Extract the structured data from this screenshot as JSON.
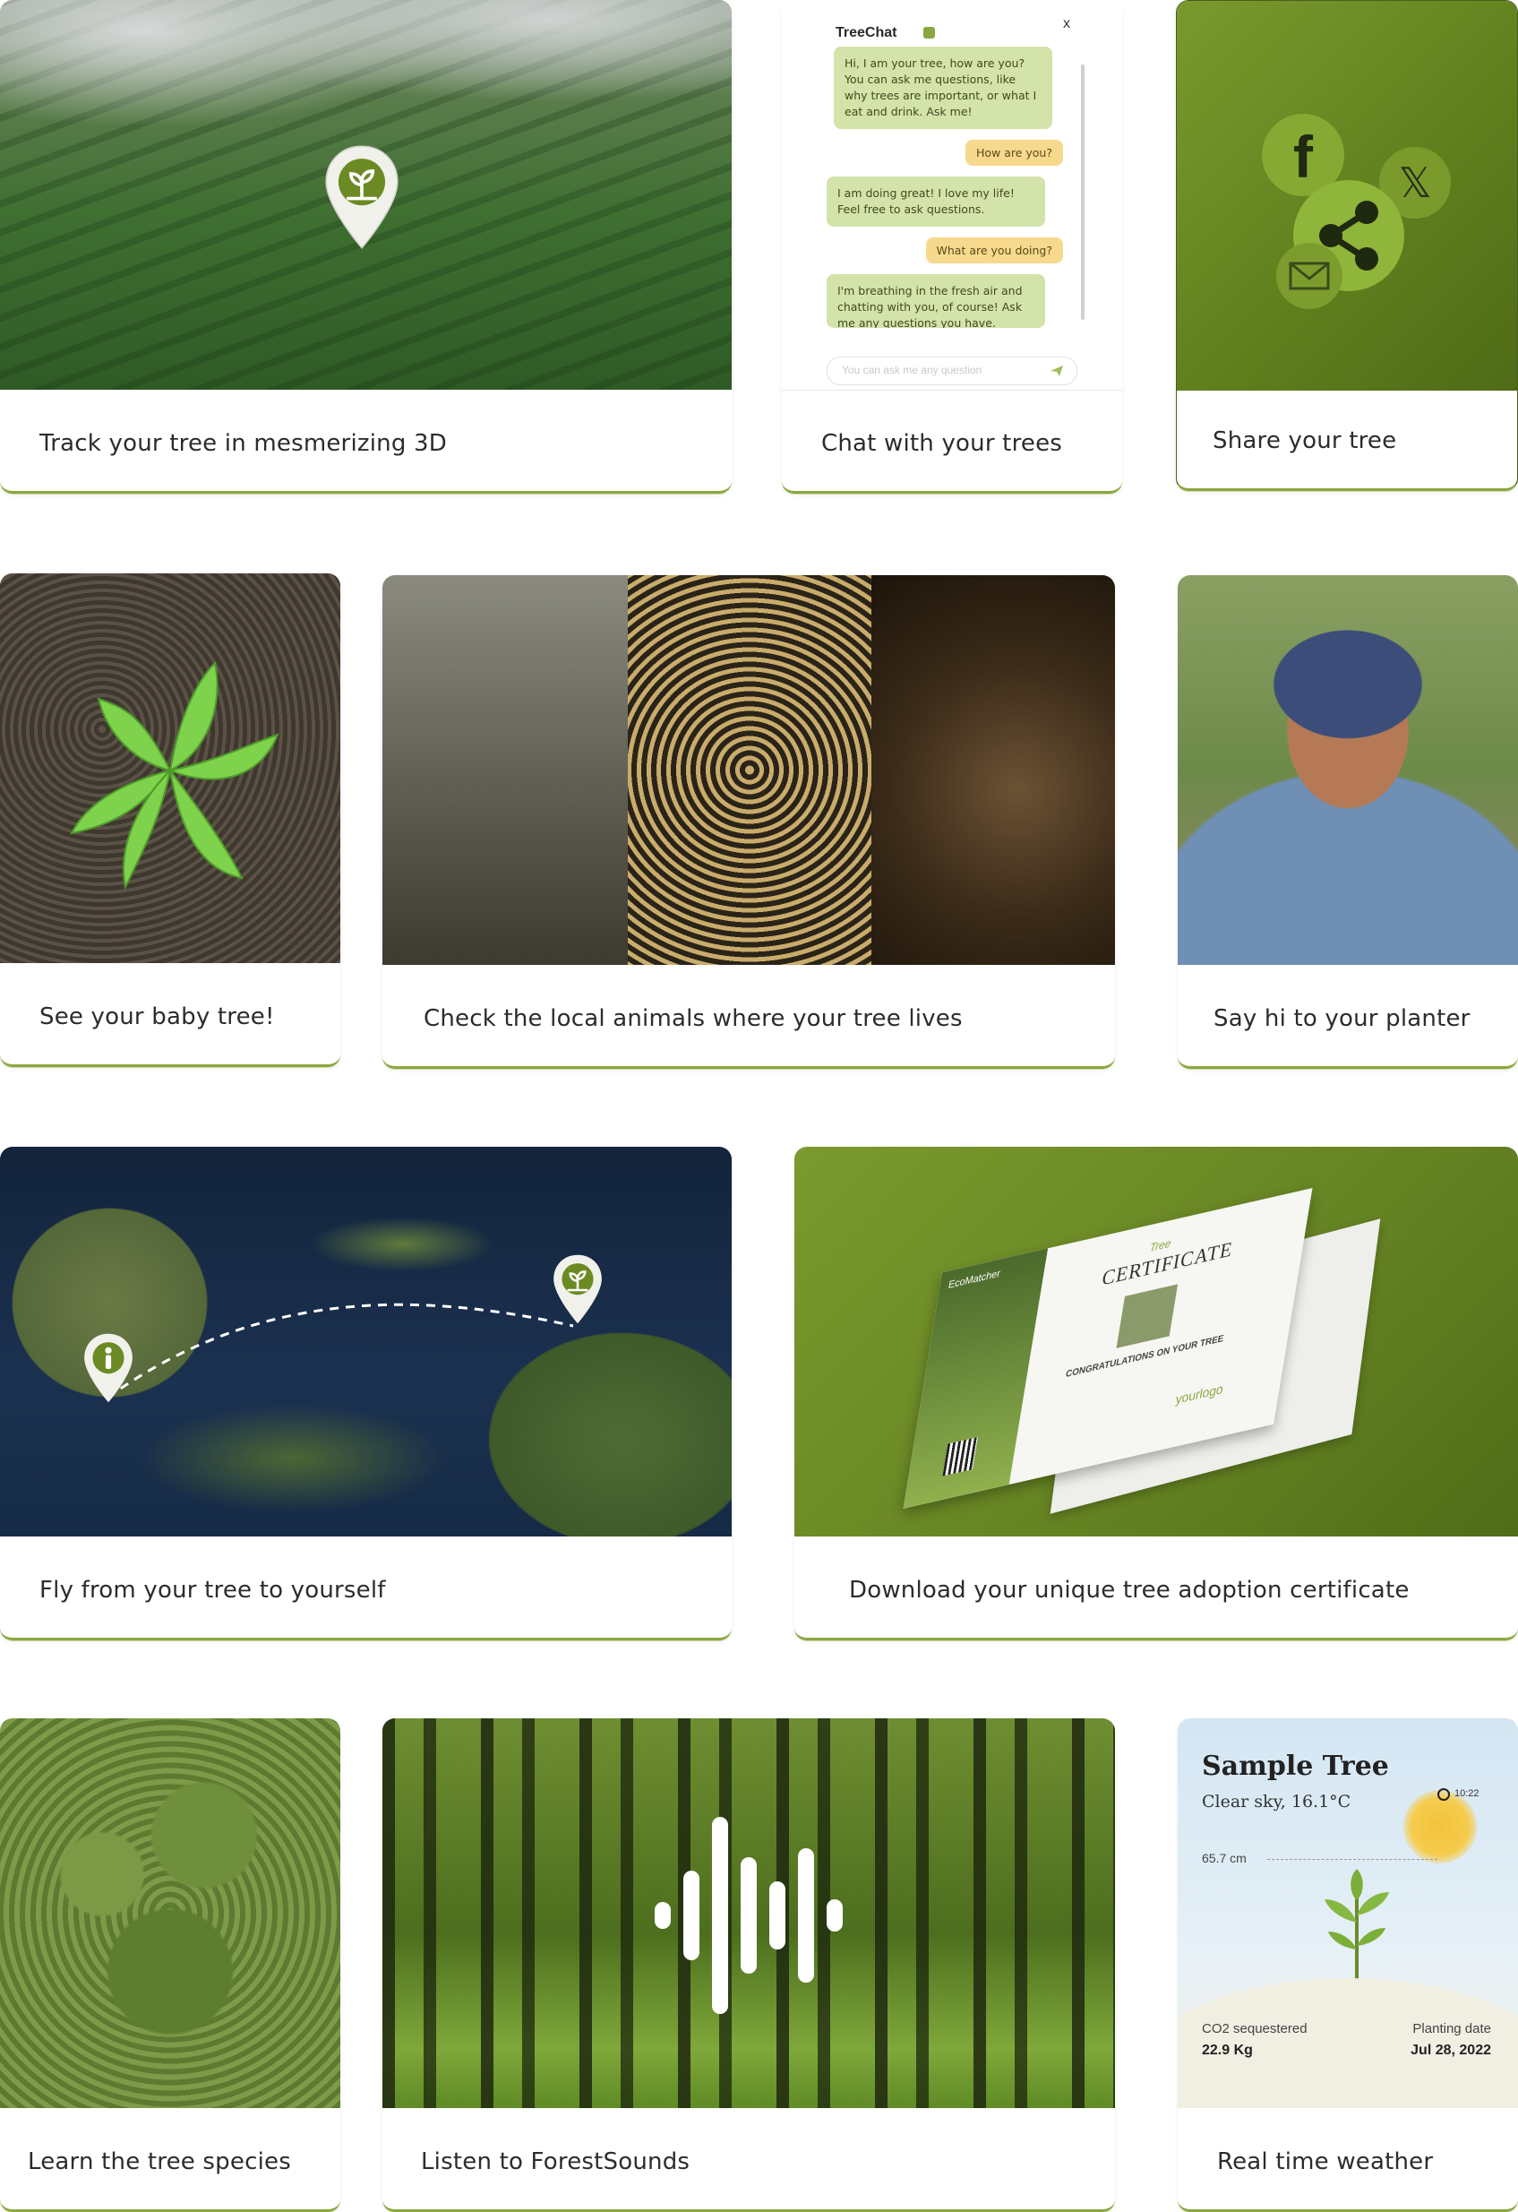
{
  "cards": {
    "track3d": {
      "caption": "Track your tree in mesmerizing 3D"
    },
    "chat": {
      "caption": "Chat with your trees",
      "title": "TreeChat",
      "close": "x",
      "messages": [
        {
          "from": "tree",
          "text": "Hi, I am your tree, how are you? You can ask me questions, like why trees are important, or what I eat and drink. Ask me!"
        },
        {
          "from": "user",
          "text": "How are you?"
        },
        {
          "from": "tree",
          "text": "I am doing great! I love my life! Feel free to ask questions."
        },
        {
          "from": "user",
          "text": "What are you doing?"
        },
        {
          "from": "tree",
          "text": "I'm breathing in the fresh air and chatting with you, of course! Ask me any questions you have."
        }
      ],
      "input_placeholder": "You can ask me any question"
    },
    "share": {
      "caption": "Share your tree",
      "icons": [
        "facebook-icon",
        "x-icon",
        "share-icon",
        "mail-icon"
      ]
    },
    "baby": {
      "caption": "See your baby tree!"
    },
    "animals": {
      "caption": "Check the local animals where your tree lives"
    },
    "planter": {
      "caption": "Say hi to your planter"
    },
    "fly": {
      "caption": "Fly from your tree to yourself"
    },
    "certificate": {
      "caption": "Download your unique tree adoption certificate",
      "doc_brand": "EcoMatcher",
      "doc_title": "CERTIFICATE",
      "doc_script": "Tree",
      "doc_congrats": "CONGRATULATIONS ON YOUR TREE",
      "doc_logo": "yourlogo"
    },
    "species": {
      "caption": "Learn the tree species"
    },
    "sounds": {
      "caption": "Listen to ForestSounds"
    },
    "weather": {
      "caption": "Real time weather",
      "tree_name": "Sample Tree",
      "conditions": "Clear sky, 16.1°C",
      "time": "10:22",
      "height": "65.7 cm",
      "co2_label": "CO2 sequestered",
      "co2_value": "22.9 Kg",
      "planting_label": "Planting date",
      "planting_value": "Jul 28, 2022"
    }
  },
  "colors": {
    "accent": "#8aa83e",
    "brand_green": "#6b8a23",
    "bubble_tree": "#d3e3a9",
    "bubble_user": "#f6d98c"
  }
}
